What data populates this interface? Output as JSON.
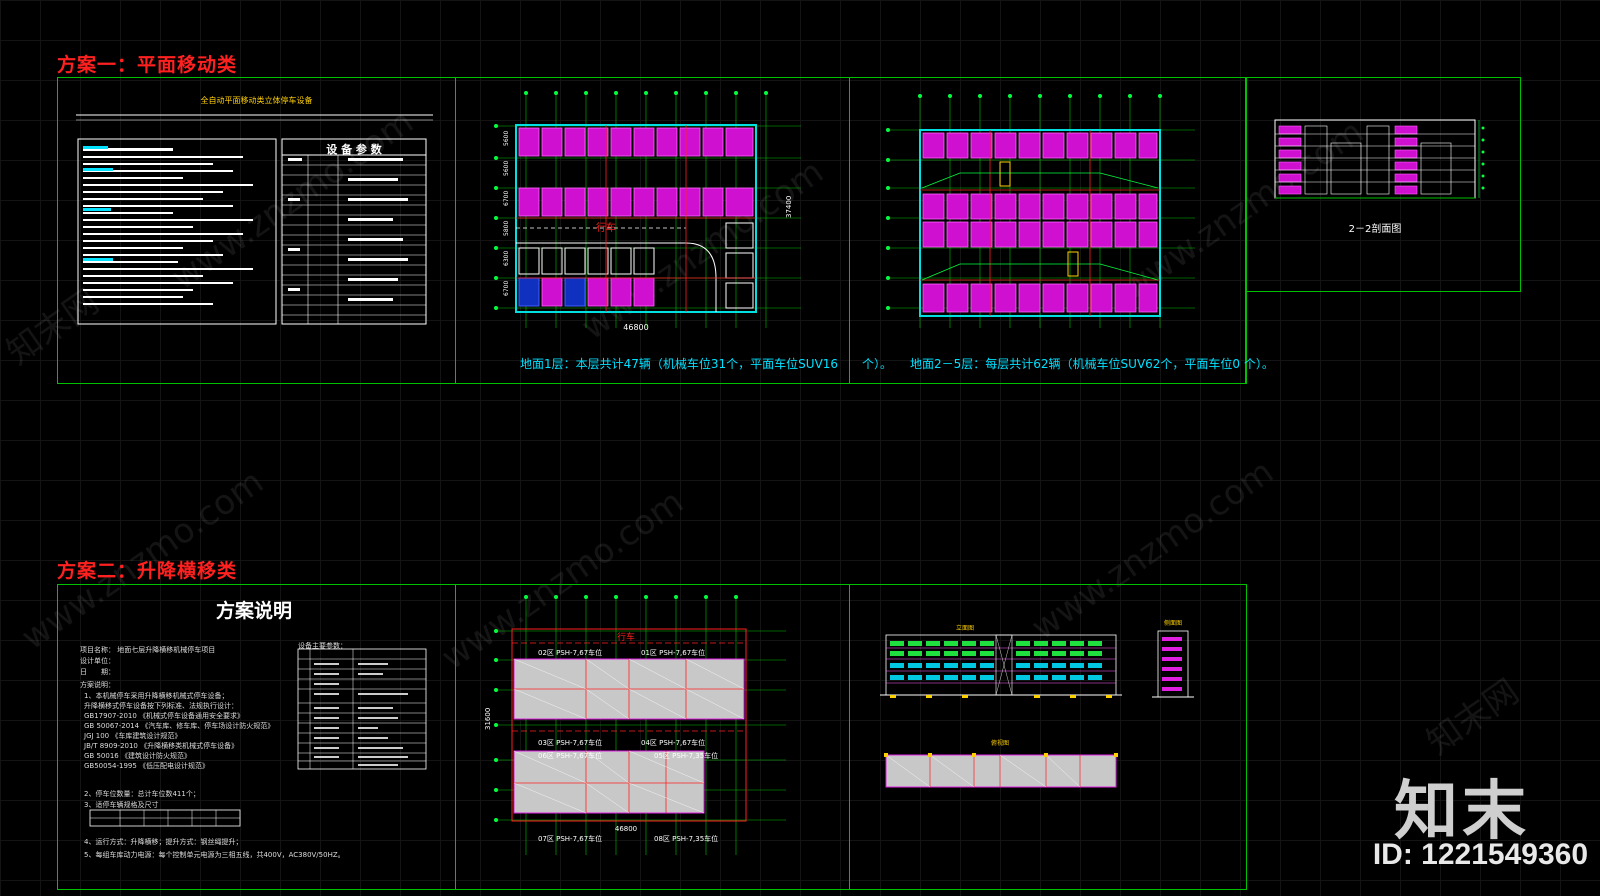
{
  "scheme1": {
    "title": "方案一：平面移动类",
    "doc_heading": "全自动平面移动类立体停车设备",
    "table_heading": "设 备 参 数",
    "plan1_dim_w": "46800",
    "plan1_dim_h": "37400",
    "plan1_rows": [
      "5600",
      "5600",
      "6700",
      "5800",
      "6300",
      "6700"
    ],
    "plan1_label_road": "行车",
    "plan1_caption": "地面1层：本层共计47辆（机械车位31个，平面车位SUV16　　个）。",
    "plan2_caption": "地面2－5层：每层共计62辆（机械车位SUV62个，平面车位0 个）。",
    "section_caption": "2－2剖面图"
  },
  "scheme2": {
    "title": "方案二：升降横移类",
    "doc_heading": "方案说明",
    "doc_lines": [
      "项目名称：  地面七层升降横移机械停车项目",
      "设计单位：",
      "日　　期：",
      "方案说明：",
      "1、本机械停车采用升降横移机械式停车设备；",
      "   升降横移式停车设备按下列标准、法规执行设计：",
      "   GB17907-2010  《机械式停车设备通用安全要求》",
      "   GB 50067-2014 《汽车库、修车库、停车场设计防火规范》",
      "   JGJ 100  《车库建筑设计规范》",
      "   JB/T 8909-2010 《升降横移类机械式停车设备》",
      "   GB 50016  《建筑设计防火规范》",
      "   GB50054-1995  《低压配电设计规范》",
      "2、停车位数量：总计车位数411个；",
      "3、适停车辆规格及尺寸",
      "4、运行方式：升降横移；提升方式：钢丝绳提升；",
      "5、每组车库动力电源：每个控制单元电源为三相五线，共400V，AC380V/50HZ。"
    ],
    "param_heading": "设备主要参数：",
    "plan_dim_w": "46800",
    "plan_dim_h": "31600",
    "plan_road": "行车",
    "plan_zones": [
      "02区  PSH-7,67车位",
      "01区  PSH-7,67车位",
      "03区  PSH-7,67车位",
      "04区  PSH-7,67车位",
      "06区  PSH-7,67车位",
      "05区  PSH-7,35车位",
      "07区  PSH-7,67车位",
      "08区  PSH-7,35车位"
    ],
    "elev_label": "立面图",
    "side_label": "侧面图",
    "top_label": "俯视图"
  },
  "brand": {
    "logo": "知末",
    "id": "ID: 1221549360",
    "watermark": "www.znzmo.com",
    "watermark_cn": "知末网"
  },
  "colors": {
    "frame": "#00c000",
    "title": "#ff2020",
    "parking": "#e020e0",
    "wall": "#00e0e0"
  }
}
